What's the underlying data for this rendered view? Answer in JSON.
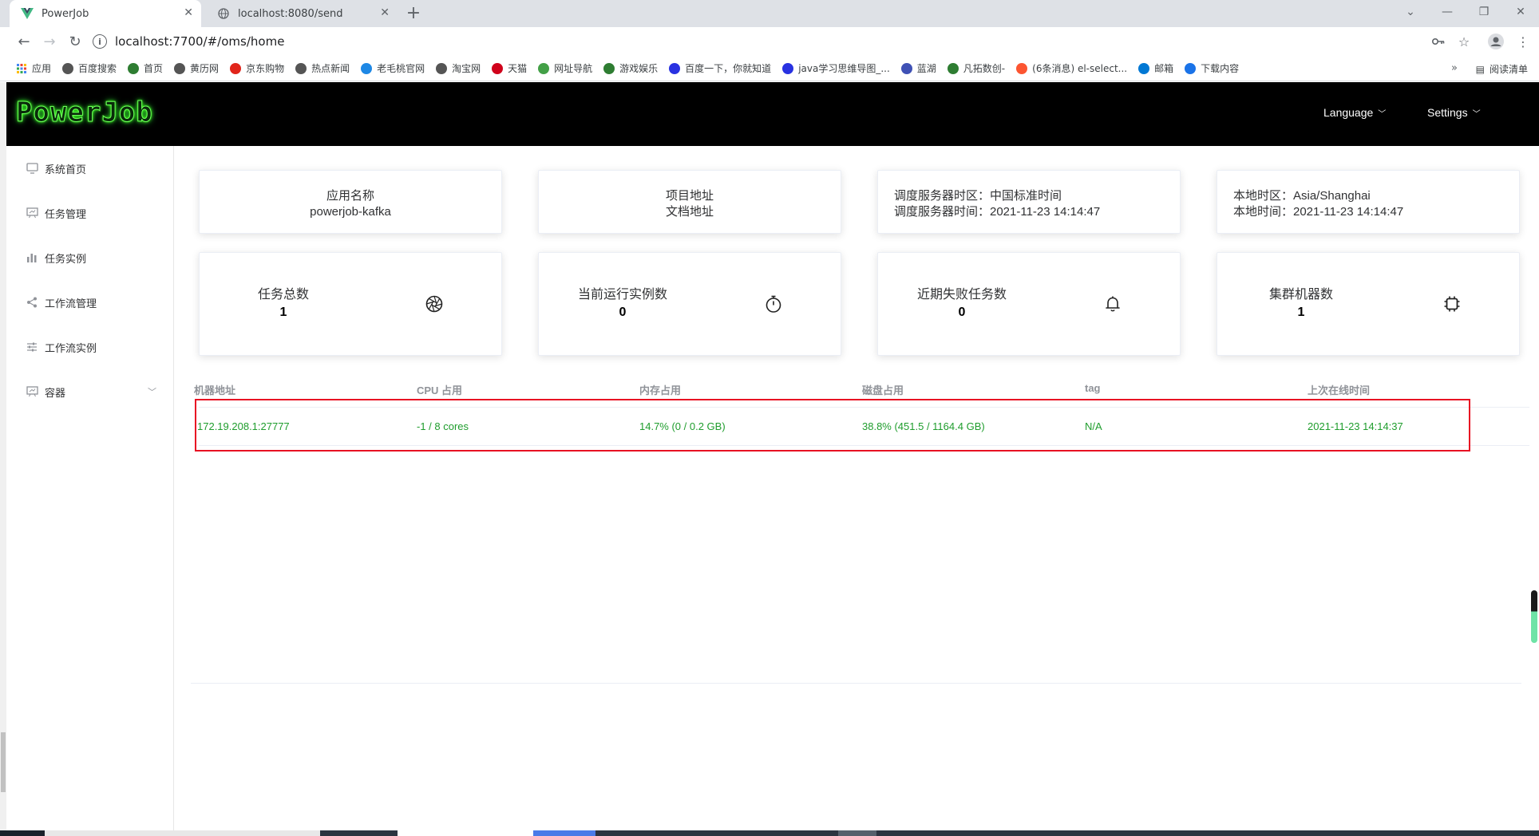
{
  "browser": {
    "tabs": [
      {
        "title": "PowerJob",
        "active": true
      },
      {
        "title": "localhost:8080/send",
        "active": false
      }
    ],
    "url": "localhost:7700/#/oms/home",
    "bookmarks": [
      {
        "label": "应用",
        "color": "#4285f4"
      },
      {
        "label": "百度搜索",
        "color": "#555555"
      },
      {
        "label": "首页",
        "color": "#2e7d32"
      },
      {
        "label": "黄历网",
        "color": "#555555"
      },
      {
        "label": "京东购物",
        "color": "#e1251b"
      },
      {
        "label": "热点新闻",
        "color": "#555555"
      },
      {
        "label": "老毛桃官网",
        "color": "#1e88e5"
      },
      {
        "label": "淘宝网",
        "color": "#555555"
      },
      {
        "label": "天猫",
        "color": "#d0021b"
      },
      {
        "label": "网址导航",
        "color": "#43a047"
      },
      {
        "label": "游戏娱乐",
        "color": "#2e7d32"
      },
      {
        "label": "百度一下，你就知道",
        "color": "#2932e1"
      },
      {
        "label": "java学习思维导图_...",
        "color": "#2932e1"
      },
      {
        "label": "蓝湖",
        "color": "#3f51b5"
      },
      {
        "label": "凡拓数创-",
        "color": "#2e7d32"
      },
      {
        "label": "(6条消息) el-select...",
        "color": "#fc5531"
      },
      {
        "label": "邮箱",
        "color": "#0078d4"
      },
      {
        "label": "下载内容",
        "color": "#1a73e8"
      }
    ],
    "bookmarks_more": "»",
    "reading_list": "阅读清单"
  },
  "header": {
    "logo": "PowerJob",
    "language": "Language",
    "settings": "Settings"
  },
  "sidebar": {
    "items": [
      {
        "label": "系统首页",
        "icon": "monitor-icon"
      },
      {
        "label": "任务管理",
        "icon": "board-icon"
      },
      {
        "label": "任务实例",
        "icon": "bar-chart-icon"
      },
      {
        "label": "工作流管理",
        "icon": "share-icon"
      },
      {
        "label": "工作流实例",
        "icon": "sliders-icon"
      },
      {
        "label": "容器",
        "icon": "board-icon"
      }
    ]
  },
  "info_cards": {
    "app": {
      "title": "应用名称",
      "value": "powerjob-kafka"
    },
    "links": {
      "project": "项目地址",
      "docs": "文档地址"
    },
    "server": {
      "timezone": "调度服务器时区：中国标准时间",
      "time": "调度服务器时间：2021-11-23 14:14:47"
    },
    "local": {
      "timezone": "本地时区：Asia/Shanghai",
      "time": "本地时间：2021-11-23 14:14:47"
    }
  },
  "stats": [
    {
      "label": "任务总数",
      "value": "1",
      "icon": "aperture-icon"
    },
    {
      "label": "当前运行实例数",
      "value": "0",
      "icon": "stopwatch-icon"
    },
    {
      "label": "近期失败任务数",
      "value": "0",
      "icon": "bell-icon"
    },
    {
      "label": "集群机器数",
      "value": "1",
      "icon": "cpu-icon"
    }
  ],
  "table": {
    "headers": [
      "机器地址",
      "CPU 占用",
      "内存占用",
      "磁盘占用",
      "tag",
      "上次在线时间"
    ],
    "rows": [
      [
        "172.19.208.1:27777",
        "-1 / 8 cores",
        "14.7%  (0 / 0.2 GB)",
        "38.8%  (451.5 / 1164.4 GB)",
        "N/A",
        "2021-11-23 14:14:37"
      ]
    ]
  },
  "colors": {
    "row_text": "#1f9d2d",
    "highlight": "#e81123",
    "header_bg": "#000000"
  }
}
